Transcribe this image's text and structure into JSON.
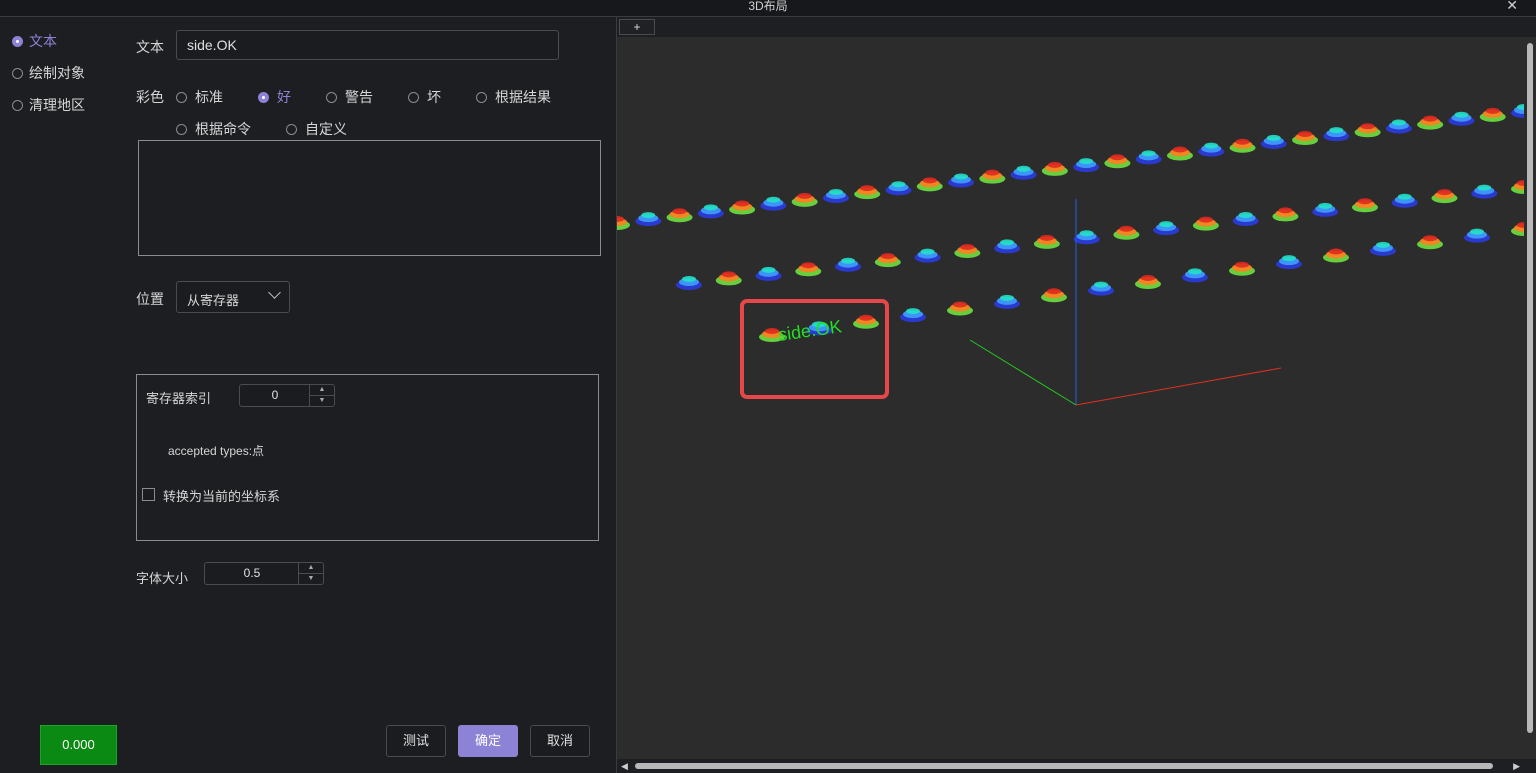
{
  "window": {
    "title": "3D布局",
    "close_symbol": "✕"
  },
  "nav": {
    "items": [
      {
        "label": "文本",
        "selected": true
      },
      {
        "label": "绘制对象",
        "selected": false
      },
      {
        "label": "清理地区",
        "selected": false
      }
    ]
  },
  "form": {
    "text_label": "文本",
    "text_value": "side.OK",
    "color_label": "彩色",
    "color_options": [
      {
        "label": "标准",
        "selected": false
      },
      {
        "label": "好",
        "selected": true
      },
      {
        "label": "警告",
        "selected": false
      },
      {
        "label": "坏",
        "selected": false
      },
      {
        "label": "根据结果",
        "selected": false
      },
      {
        "label": "根据命令",
        "selected": false
      },
      {
        "label": "自定义",
        "selected": false
      }
    ],
    "position_label": "位置",
    "position_value": "从寄存器",
    "register_index_label": "寄存器索引",
    "register_index_value": "0",
    "accepted_types": "accepted types:点",
    "convert_label": "转换为当前的坐标系",
    "convert_checked": false,
    "font_size_label": "字体大小",
    "font_size_value": "0.5"
  },
  "status": {
    "value": "0.000",
    "color": "#0a8a12"
  },
  "buttons": {
    "test": "测试",
    "ok": "确定",
    "cancel": "取消"
  },
  "viewport": {
    "add_tab": "+",
    "overlay_text": "side.OK",
    "overlay_text_color": "#22e022",
    "highlight_color": "#e8474a",
    "axis_colors": {
      "x": "#e03020",
      "y": "#22cc22",
      "z": "#2060e0"
    }
  },
  "accent_color": "#8c82d6"
}
